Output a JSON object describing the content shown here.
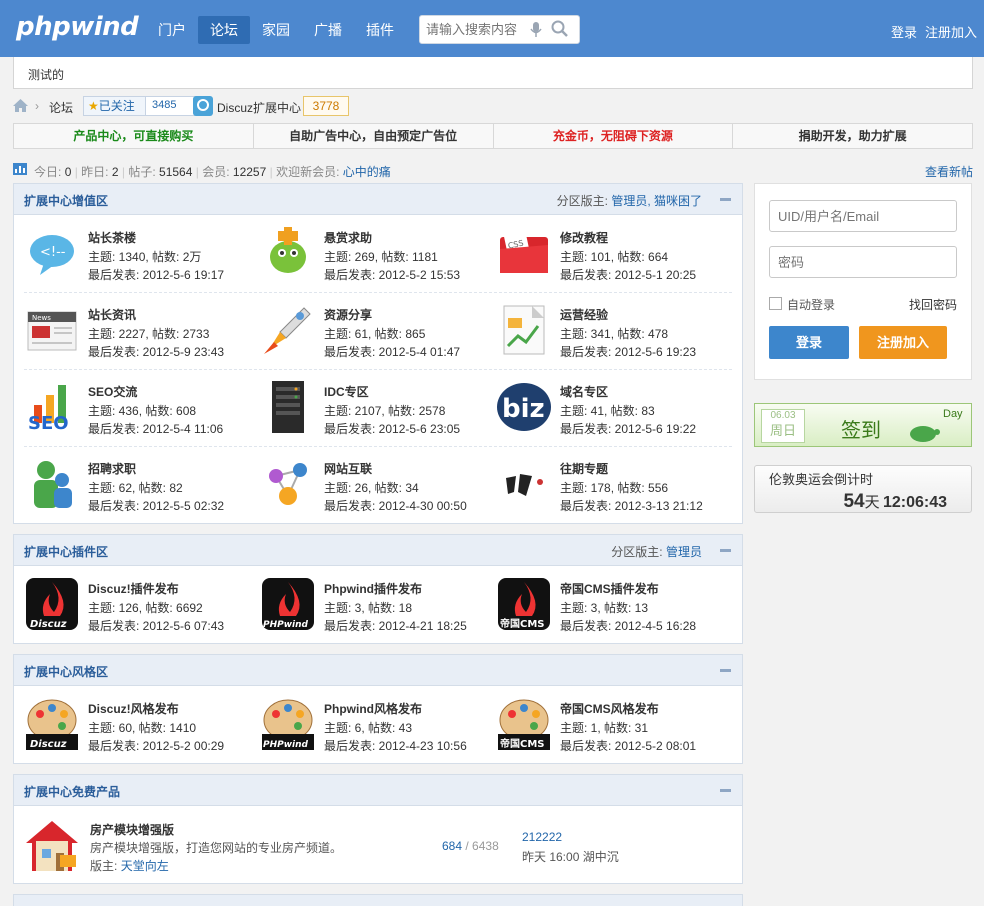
{
  "header": {
    "logo": "phpwind",
    "nav": [
      "门户",
      "论坛",
      "家园",
      "广播",
      "插件"
    ],
    "search_placeholder": "请输入搜索内容",
    "login": "登录",
    "register": "注册加入"
  },
  "notice": "测试的",
  "breadcrumb": {
    "item": "论坛",
    "follow_label": "已关注",
    "follow_count": "3485",
    "ext_name": "Discuz扩展中心",
    "ext_count": "3778"
  },
  "adbar": [
    {
      "text": "产品中心，可直接购买",
      "color": "#1a8a1a"
    },
    {
      "text": "自助广告中心，自由预定广告位",
      "color": "#333333"
    },
    {
      "text": "充金币，无阻碍下资源",
      "color": "#dd2222"
    },
    {
      "text": "捐助开发，助力扩展",
      "color": "#333333"
    }
  ],
  "stats": {
    "today_label": "今日:",
    "today": "0",
    "yesterday_label": "昨日:",
    "yesterday": "2",
    "posts_label": "帖子:",
    "posts": "51564",
    "members_label": "会员:",
    "members": "12257",
    "welcome_label": "欢迎新会员:",
    "newest_member": "心中的痛",
    "view_new": "查看新帖"
  },
  "sections": [
    {
      "title": "扩展中心增值区",
      "mod_label": "分区版主:",
      "mods": "管理员, 猫咪困了",
      "forums": [
        {
          "name": "站长茶楼",
          "stat": "主题: 1340, 帖数: 2万",
          "last": "最后发表: 2012-5-6 19:17",
          "icon": "chat-bubble-icon"
        },
        {
          "name": "悬赏求助",
          "stat": "主题: 269, 帖数: 1181",
          "last": "最后发表: 2012-5-2 15:53",
          "icon": "reward-icon"
        },
        {
          "name": "修改教程",
          "stat": "主题: 101, 帖数: 664",
          "last": "最后发表: 2012-5-1 20:25",
          "icon": "folder-css-icon"
        },
        {
          "name": "站长资讯",
          "stat": "主题: 2227, 帖数: 2733",
          "last": "最后发表: 2012-5-9 23:43",
          "icon": "newspaper-icon"
        },
        {
          "name": "资源分享",
          "stat": "主题: 61, 帖数: 865",
          "last": "最后发表: 2012-5-4 01:47",
          "icon": "rocket-icon"
        },
        {
          "name": "运营经验",
          "stat": "主题: 341, 帖数: 478",
          "last": "最后发表: 2012-5-6 19:23",
          "icon": "report-icon"
        },
        {
          "name": "SEO交流",
          "stat": "主题: 436, 帖数: 608",
          "last": "最后发表: 2012-5-4 11:06",
          "icon": "seo-icon"
        },
        {
          "name": "IDC专区",
          "stat": "主题: 2107, 帖数: 2578",
          "last": "最后发表: 2012-5-6 23:05",
          "icon": "server-icon"
        },
        {
          "name": "域名专区",
          "stat": "主题: 41, 帖数: 83",
          "last": "最后发表: 2012-5-6 19:22",
          "icon": "biz-icon"
        },
        {
          "name": "招聘求职",
          "stat": "主题: 62, 帖数: 82",
          "last": "最后发表: 2012-5-5 02:32",
          "icon": "users-icon"
        },
        {
          "name": "网站互联",
          "stat": "主题: 26, 帖数: 34",
          "last": "最后发表: 2012-4-30 00:50",
          "icon": "network-icon"
        },
        {
          "name": "往期专题",
          "stat": "主题: 178, 帖数: 556",
          "last": "最后发表: 2012-3-13 21:12",
          "icon": "focus-icon"
        }
      ]
    },
    {
      "title": "扩展中心插件区",
      "mod_label": "分区版主:",
      "mods": "管理员",
      "forums": [
        {
          "name": "Discuz!插件发布",
          "stat": "主题: 126, 帖数: 6692",
          "last": "最后发表: 2012-5-6 07:43",
          "icon": "discuz-plugin-icon",
          "caption": "Discuz"
        },
        {
          "name": "Phpwind插件发布",
          "stat": "主题: 3, 帖数: 18",
          "last": "最后发表: 2012-4-21 18:25",
          "icon": "phpwind-plugin-icon",
          "caption": "PHPwind"
        },
        {
          "name": "帝国CMS插件发布",
          "stat": "主题: 3, 帖数: 13",
          "last": "最后发表: 2012-4-5 16:28",
          "icon": "empire-plugin-icon",
          "caption": "帝国CMS"
        }
      ]
    },
    {
      "title": "扩展中心风格区",
      "mods": "",
      "forums": [
        {
          "name": "Discuz!风格发布",
          "stat": "主题: 60, 帖数: 1410",
          "last": "最后发表: 2012-5-2 00:29",
          "icon": "discuz-style-icon",
          "caption": "Discuz"
        },
        {
          "name": "Phpwind风格发布",
          "stat": "主题: 6, 帖数: 43",
          "last": "最后发表: 2012-4-23 10:56",
          "icon": "phpwind-style-icon",
          "caption": "PHPwind"
        },
        {
          "name": "帝国CMS风格发布",
          "stat": "主题: 1, 帖数: 31",
          "last": "最后发表: 2012-5-2 08:01",
          "icon": "empire-style-icon",
          "caption": "帝国CMS"
        }
      ]
    },
    {
      "title": "扩展中心免费产品",
      "forum": {
        "name": "房产模块增强版",
        "desc": "房产模块增强版，打造您网站的专业房产频道。",
        "mod_label": "版主:",
        "mod": "天堂向左",
        "threads": "684",
        "posts": "6438",
        "last_title": "212222",
        "last_info": "昨天 16:00 湖中沉"
      }
    }
  ],
  "sidebar": {
    "user_placeholder": "UID/用户名/Email",
    "password_placeholder": "密码",
    "auto_login": "自动登录",
    "forgot": "找回密码",
    "login_btn": "登录",
    "register_btn": "注册加入",
    "sign_date": "06.03",
    "sign_weekday": "周日",
    "sign_text": "签到",
    "sign_day": "Day",
    "countdown_title": "伦敦奥运会倒计时",
    "countdown_days": "54",
    "countdown_days_unit": "天",
    "countdown_time": "12:06:43"
  },
  "colors": {
    "header": "#4d88cf",
    "login_btn": "#3d86cc",
    "register_btn": "#f0961e",
    "link": "#2266aa"
  }
}
